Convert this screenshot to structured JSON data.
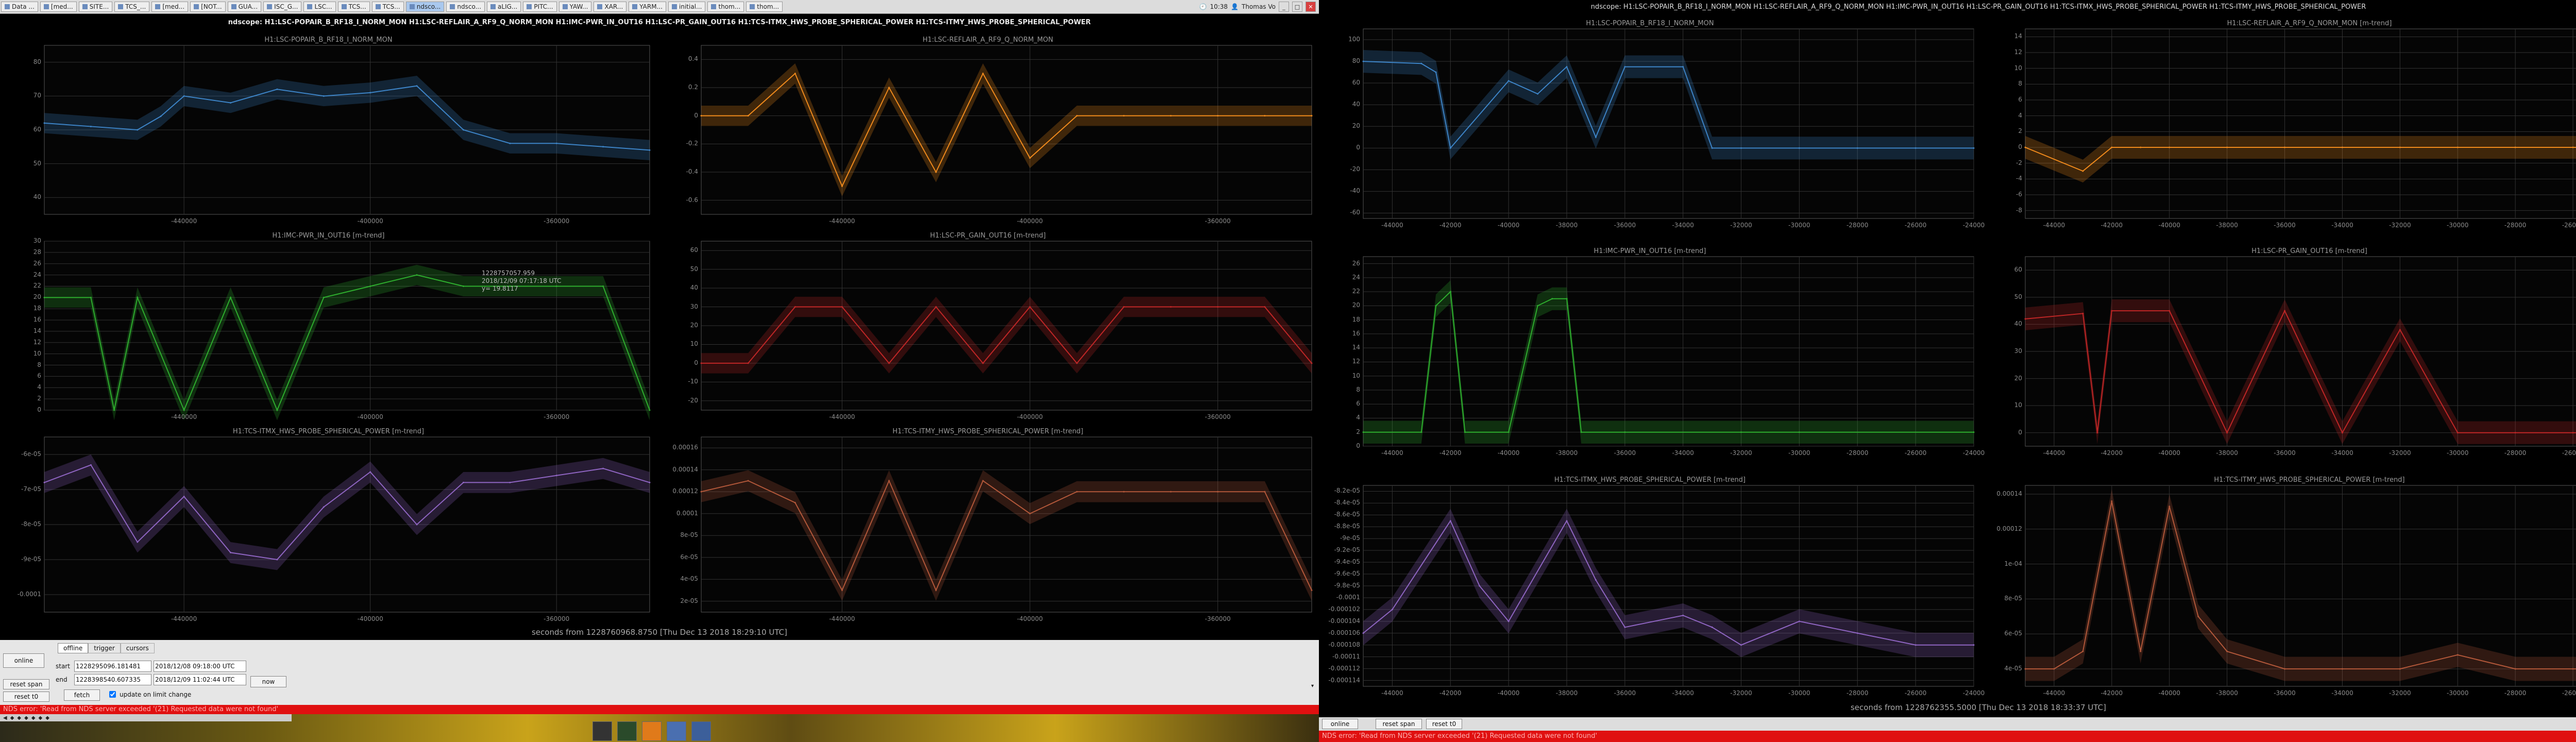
{
  "taskbar": {
    "items": [
      "Data ...",
      "[med...",
      "SITE...",
      "TCS_...",
      "[med...",
      "[NOT...",
      "GUA...",
      "ISC_G...",
      "LSC...",
      "TCS...",
      "TCS...",
      "ndsco...",
      "ndsco...",
      "aLIG...",
      "PITC...",
      "YAW...",
      "XAR...",
      "YARM...",
      "initial...",
      "thom...",
      "thom..."
    ],
    "active_index": 11,
    "clock": "10:38",
    "user": "Thomas Vo"
  },
  "left_window": {
    "title": "ndscope: H1:LSC-POPAIR_B_RF18_I_NORM_MON H1:LSC-REFLAIR_A_RF9_Q_NORM_MON H1:IMC-PWR_IN_OUT16 H1:LSC-PR_GAIN_OUT16 H1:TCS-ITMX_HWS_PROBE_SPHERICAL_POWER H1:TCS-ITMY_HWS_PROBE_SPHERICAL_POWER",
    "xaxis_label": "seconds from 1228760968.8750 [Thu Dec 13 2018 18:29:10 UTC]",
    "tooltip": "1228757057.959\n2018/12/09 07:17:18 UTC\ny= 19.8117",
    "controls": {
      "tabs": [
        "offline",
        "trigger",
        "cursors"
      ],
      "online_label": "online",
      "reset_span_label": "reset span",
      "reset_t0_label": "reset t0",
      "start_label": "start",
      "end_label": "end",
      "start_gps": "1228295096.181481",
      "start_utc": "2018/12/08 09:18:00 UTC",
      "end_gps": "1228398540.607335",
      "end_utc": "2018/12/09 11:02:44 UTC",
      "fetch_label": "fetch",
      "now_label": "now",
      "update_label": "update on limit change",
      "update_checked": true
    },
    "status": "NDS error: 'Read from NDS server exceeded '(21) Requested data were not found'"
  },
  "right_window": {
    "title": "ndscope: H1:LSC-POPAIR_B_RF18_I_NORM_MON H1:LSC-REFLAIR_A_RF9_Q_NORM_MON H1:IMC-PWR_IN_OUT16 H1:LSC-PR_GAIN_OUT16 H1:TCS-ITMX_HWS_PROBE_SPHERICAL_POWER H1:TCS-ITMY_HWS_PROBE_SPHERICAL_POWER",
    "xaxis_label": "seconds from 1228762355.5000 [Thu Dec 13 2018 18:33:37 UTC]",
    "controls": {
      "online_label": "online",
      "reset_span_label": "reset span",
      "reset_t0_label": "reset t0"
    },
    "status": "NDS error: 'Read from NDS server exceeded '(21) Requested data were not found'"
  },
  "colors": {
    "blue": "#3d84c7",
    "orange": "#f08a1c",
    "green": "#2eae2e",
    "red": "#c02626",
    "purple": "#8f65c2",
    "brown": "#b3583a",
    "grid": "#333333",
    "status": "#e01010"
  },
  "chart_data": [
    {
      "type": "line",
      "window": "left",
      "title": "H1:LSC-POPAIR_B_RF18_I_NORM_MON",
      "color": "blue",
      "yticks": [
        "80",
        "70",
        "60",
        "50",
        "40"
      ],
      "ylim": [
        35,
        85
      ],
      "xticks": [
        "-440000",
        "-400000",
        "-360000"
      ],
      "x": [
        -470000,
        -460000,
        -450000,
        -445000,
        -440000,
        -430000,
        -420000,
        -410000,
        -400000,
        -390000,
        -380000,
        -370000,
        -360000,
        -350000,
        -340000
      ],
      "values": [
        62,
        61,
        60,
        64,
        70,
        68,
        72,
        70,
        71,
        73,
        60,
        56,
        56,
        55,
        54
      ]
    },
    {
      "type": "line",
      "window": "left",
      "title": "H1:LSC-REFLAIR_A_RF9_Q_NORM_MON",
      "color": "orange",
      "yticks": [
        "0.4",
        "0.2",
        "0",
        "-0.2",
        "-0.4",
        "-0.6"
      ],
      "ylim": [
        -0.7,
        0.5
      ],
      "xticks": [
        "-440000",
        "-400000",
        "-360000"
      ],
      "x": [
        -470000,
        -460000,
        -450000,
        -440000,
        -430000,
        -420000,
        -410000,
        -400000,
        -390000,
        -380000,
        -370000,
        -360000,
        -350000,
        -340000
      ],
      "values": [
        0,
        0,
        0.3,
        -0.5,
        0.2,
        -0.4,
        0.3,
        -0.3,
        0,
        0,
        0,
        0,
        0,
        0
      ]
    },
    {
      "type": "line",
      "window": "left",
      "title": "H1:IMC-PWR_IN_OUT16 [m-trend]",
      "color": "green",
      "yticks": [
        "30",
        "28",
        "26",
        "24",
        "22",
        "20",
        "18",
        "16",
        "14",
        "12",
        "10",
        "8",
        "6",
        "4",
        "2",
        "0"
      ],
      "ylim": [
        0,
        30
      ],
      "xticks": [
        "-440000",
        "-400000",
        "-360000"
      ],
      "x": [
        -470000,
        -460000,
        -455000,
        -450000,
        -440000,
        -430000,
        -420000,
        -410000,
        -400000,
        -390000,
        -380000,
        -370000,
        -360000,
        -350000,
        -340000
      ],
      "values": [
        20,
        20,
        0,
        20,
        0,
        20,
        0,
        20,
        22,
        24,
        22,
        22,
        22,
        22,
        0
      ]
    },
    {
      "type": "line",
      "window": "left",
      "title": "H1:LSC-PR_GAIN_OUT16 [m-trend]",
      "color": "red",
      "yticks": [
        "60",
        "50",
        "40",
        "30",
        "20",
        "10",
        "0",
        "-10",
        "-20"
      ],
      "ylim": [
        -25,
        65
      ],
      "xticks": [
        "-440000",
        "-400000",
        "-360000"
      ],
      "x": [
        -470000,
        -460000,
        -450000,
        -440000,
        -430000,
        -420000,
        -410000,
        -400000,
        -390000,
        -380000,
        -370000,
        -360000,
        -350000,
        -340000
      ],
      "values": [
        0,
        0,
        30,
        30,
        0,
        30,
        0,
        30,
        0,
        30,
        30,
        30,
        30,
        0
      ]
    },
    {
      "type": "line",
      "window": "left",
      "title": "H1:TCS-ITMX_HWS_PROBE_SPHERICAL_POWER [m-trend]",
      "color": "purple",
      "yticks": [
        "-6e-05",
        "-7e-05",
        "-8e-05",
        "-9e-05",
        "-0.0001"
      ],
      "ylim": [
        -0.000105,
        -5.5e-05
      ],
      "xticks": [
        "-440000",
        "-400000",
        "-360000"
      ],
      "x": [
        -470000,
        -460000,
        -450000,
        -440000,
        -430000,
        -420000,
        -410000,
        -400000,
        -390000,
        -380000,
        -370000,
        -360000,
        -350000,
        -340000
      ],
      "values": [
        -6.8e-05,
        -6.3e-05,
        -8.5e-05,
        -7.2e-05,
        -8.8e-05,
        -9e-05,
        -7.5e-05,
        -6.5e-05,
        -8e-05,
        -6.8e-05,
        -6.8e-05,
        -6.6e-05,
        -6.4e-05,
        -6.8e-05
      ]
    },
    {
      "type": "line",
      "window": "left",
      "title": "H1:TCS-ITMY_HWS_PROBE_SPHERICAL_POWER [m-trend]",
      "color": "brown",
      "yticks": [
        "0.00016",
        "0.00014",
        "0.00012",
        "0.0001",
        "8e-05",
        "6e-05",
        "4e-05",
        "2e-05"
      ],
      "ylim": [
        1e-05,
        0.00017
      ],
      "xticks": [
        "-440000",
        "-400000",
        "-360000"
      ],
      "x": [
        -470000,
        -460000,
        -450000,
        -440000,
        -430000,
        -420000,
        -410000,
        -400000,
        -390000,
        -380000,
        -370000,
        -360000,
        -350000,
        -340000
      ],
      "values": [
        0.00012,
        0.00013,
        0.00011,
        3e-05,
        0.00013,
        3e-05,
        0.00013,
        0.0001,
        0.00012,
        0.00012,
        0.00012,
        0.00012,
        0.00012,
        3e-05
      ]
    },
    {
      "type": "line",
      "window": "right",
      "title": "H1:LSC-POPAIR_B_RF18_I_NORM_MON",
      "color": "blue",
      "yticks": [
        "100",
        "80",
        "60",
        "40",
        "20",
        "0",
        "-20",
        "-40",
        "-60"
      ],
      "ylim": [
        -65,
        110
      ],
      "xticks": [
        "-44000",
        "-42000",
        "-40000",
        "-38000",
        "-36000",
        "-34000",
        "-32000",
        "-30000",
        "-28000",
        "-26000",
        "-24000"
      ],
      "x": [
        -45000,
        -43000,
        -42500,
        -42000,
        -40000,
        -39000,
        -38000,
        -37000,
        -36000,
        -34000,
        -33000,
        -32000,
        -30000,
        -28000,
        -26000,
        -24000
      ],
      "values": [
        80,
        78,
        70,
        0,
        62,
        50,
        75,
        10,
        75,
        75,
        0,
        0,
        0,
        0,
        0,
        0
      ]
    },
    {
      "type": "line",
      "window": "right",
      "title": "H1:LSC-REFLAIR_A_RF9_Q_NORM_MON [m-trend]",
      "color": "orange",
      "yticks": [
        "14",
        "12",
        "10",
        "8",
        "6",
        "4",
        "2",
        "0",
        "-2",
        "-4",
        "-6",
        "-8"
      ],
      "ylim": [
        -9,
        15
      ],
      "xticks": [
        "-44000",
        "-42000",
        "-40000",
        "-38000",
        "-36000",
        "-34000",
        "-32000",
        "-30000",
        "-28000",
        "-26000",
        "-24000"
      ],
      "x": [
        -45000,
        -43000,
        -42000,
        -41000,
        -40000,
        -38000,
        -36000,
        -34000,
        -32000,
        -30000,
        -28000,
        -26000,
        -24000
      ],
      "values": [
        0,
        -3,
        0,
        0,
        0,
        0,
        0,
        0,
        0,
        0,
        0,
        0,
        0
      ]
    },
    {
      "type": "line",
      "window": "right",
      "title": "H1:IMC-PWR_IN_OUT16 [m-trend]",
      "color": "green",
      "yticks": [
        "26",
        "24",
        "22",
        "20",
        "18",
        "16",
        "14",
        "12",
        "10",
        "8",
        "6",
        "4",
        "2",
        "0"
      ],
      "ylim": [
        0,
        27
      ],
      "xticks": [
        "-44000",
        "-42000",
        "-40000",
        "-38000",
        "-36000",
        "-34000",
        "-32000",
        "-30000",
        "-28000",
        "-26000",
        "-24000"
      ],
      "x": [
        -45000,
        -43000,
        -42500,
        -42000,
        -41500,
        -40000,
        -39000,
        -38500,
        -38000,
        -37500,
        -36000,
        -32000,
        -30000,
        -24000
      ],
      "values": [
        2,
        2,
        20,
        22,
        2,
        2,
        20,
        21,
        21,
        2,
        2,
        2,
        2,
        2
      ]
    },
    {
      "type": "line",
      "window": "right",
      "title": "H1:LSC-PR_GAIN_OUT16 [m-trend]",
      "color": "red",
      "yticks": [
        "60",
        "50",
        "40",
        "30",
        "20",
        "10",
        "0"
      ],
      "ylim": [
        -5,
        65
      ],
      "xticks": [
        "-44000",
        "-42000",
        "-40000",
        "-38000",
        "-36000",
        "-34000",
        "-32000",
        "-30000",
        "-28000",
        "-26000",
        "-24000"
      ],
      "x": [
        -45000,
        -43000,
        -42500,
        -42000,
        -40000,
        -38000,
        -36000,
        -34000,
        -32000,
        -30000,
        -28000,
        -26000,
        -24000
      ],
      "values": [
        42,
        44,
        0,
        45,
        45,
        0,
        45,
        0,
        38,
        0,
        0,
        0,
        0
      ]
    },
    {
      "type": "line",
      "window": "right",
      "title": "H1:TCS-ITMX_HWS_PROBE_SPHERICAL_POWER [m-trend]",
      "color": "purple",
      "yticks": [
        "-8.2e-05",
        "-8.4e-05",
        "-8.6e-05",
        "-8.8e-05",
        "-9e-05",
        "-9.2e-05",
        "-9.4e-05",
        "-9.6e-05",
        "-9.8e-05",
        "-0.0001",
        "-0.000102",
        "-0.000104",
        "-0.000106",
        "-0.000108",
        "-0.00011",
        "-0.000112",
        "-0.000114"
      ],
      "ylim": [
        -0.000115,
        -8.1e-05
      ],
      "xticks": [
        "-44000",
        "-42000",
        "-40000",
        "-38000",
        "-36000",
        "-34000",
        "-32000",
        "-30000",
        "-28000",
        "-26000",
        "-24000"
      ],
      "x": [
        -45000,
        -44000,
        -42000,
        -41000,
        -40000,
        -38000,
        -37000,
        -36000,
        -34000,
        -33000,
        -32000,
        -30000,
        -28000,
        -26000,
        -24000
      ],
      "values": [
        -0.000106,
        -0.000102,
        -8.7e-05,
        -9.8e-05,
        -0.000104,
        -8.7e-05,
        -9.7e-05,
        -0.000105,
        -0.000103,
        -0.000105,
        -0.000108,
        -0.000104,
        -0.000106,
        -0.000108,
        -0.000108
      ]
    },
    {
      "type": "line",
      "window": "right",
      "title": "H1:TCS-ITMY_HWS_PROBE_SPHERICAL_POWER [m-trend]",
      "color": "brown",
      "yticks": [
        "0.00014",
        "0.00012",
        "1e-04",
        "8e-05",
        "6e-05",
        "4e-05"
      ],
      "ylim": [
        3e-05,
        0.000145
      ],
      "xticks": [
        "-44000",
        "-42000",
        "-40000",
        "-38000",
        "-36000",
        "-34000",
        "-32000",
        "-30000",
        "-28000",
        "-26000",
        "-24000"
      ],
      "x": [
        -45000,
        -44000,
        -43000,
        -42000,
        -41000,
        -40000,
        -39000,
        -38000,
        -36000,
        -34000,
        -32000,
        -30000,
        -28000,
        -26000,
        -24000
      ],
      "values": [
        4e-05,
        4e-05,
        5e-05,
        0.000136,
        5e-05,
        0.000133,
        7e-05,
        5e-05,
        4e-05,
        4e-05,
        4e-05,
        4.8e-05,
        4e-05,
        4e-05,
        4e-05
      ]
    }
  ]
}
